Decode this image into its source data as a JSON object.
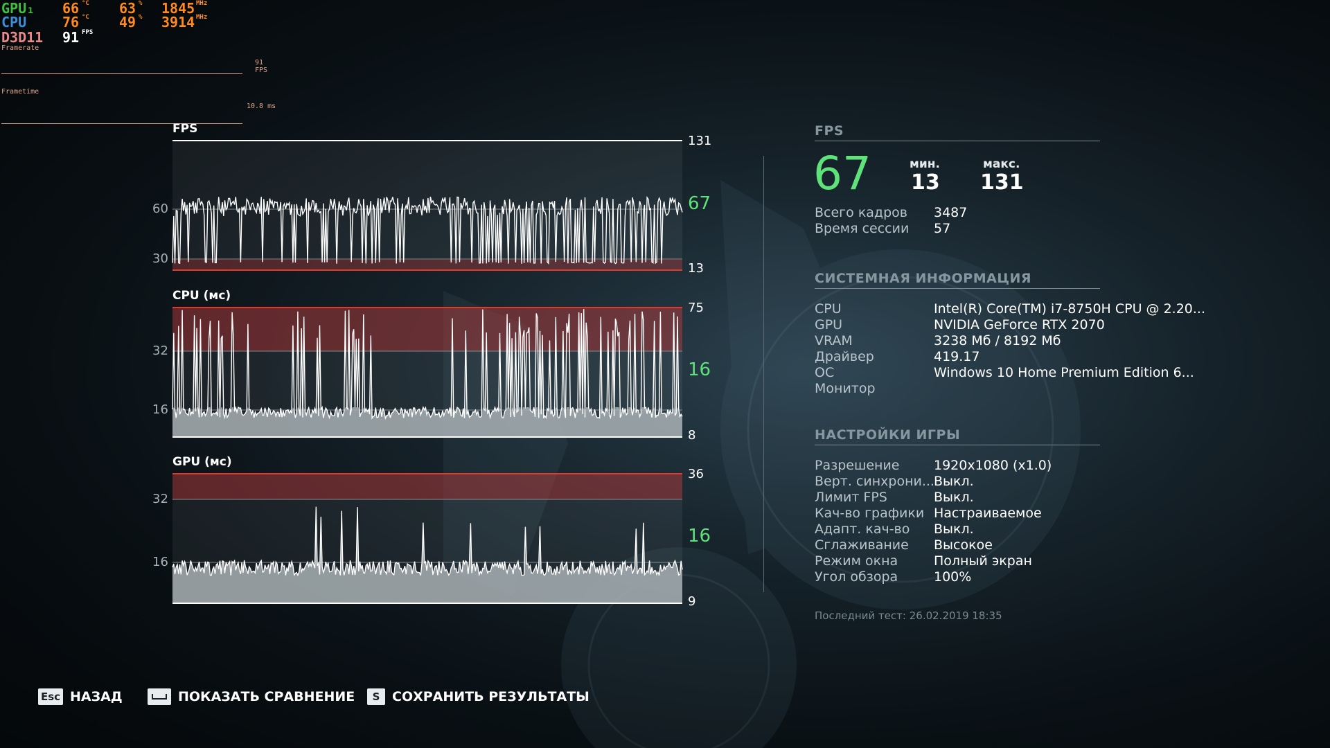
{
  "osd": {
    "rows": [
      {
        "name": "GPU₁",
        "color": "#3fbf3f",
        "temp": "66",
        "temp_unit": "°C",
        "load": "63",
        "load_unit": "%",
        "clock": "1845",
        "clock_unit": "MHz"
      },
      {
        "name": "CPU",
        "color": "#3c8fd8",
        "temp": "76",
        "temp_unit": "°C",
        "load": "49",
        "load_unit": "%",
        "clock": "3914",
        "clock_unit": "MHz"
      }
    ],
    "api": {
      "name": "D3D11",
      "color": "#e88a8a",
      "fps": "91",
      "fps_unit": "FPS"
    },
    "framerate_label": "Framerate",
    "framerate_value": "91 FPS",
    "frametime_label": "Frametime",
    "frametime_value": "10.8 ms"
  },
  "charts": {
    "fps": {
      "title": "FPS",
      "max": "131",
      "current": "67",
      "min": "13",
      "grid": [
        "60",
        "30"
      ]
    },
    "cpu": {
      "title": "CPU (мс)",
      "max": "75",
      "current": "16",
      "min": "8",
      "grid": [
        "32",
        "16"
      ]
    },
    "gpu": {
      "title": "GPU (мс)",
      "max": "36",
      "current": "16",
      "min": "9",
      "grid": [
        "32",
        "16"
      ]
    }
  },
  "chart_data": [
    {
      "type": "line",
      "title": "FPS",
      "ylim": [
        13,
        131
      ],
      "summary": {
        "current": 67,
        "min": 13,
        "max": 131
      },
      "grid": [
        30,
        60
      ]
    },
    {
      "type": "area",
      "title": "CPU (мс)",
      "ylim": [
        8,
        75
      ],
      "summary": {
        "current": 16,
        "min": 8,
        "max": 75
      },
      "grid": [
        16,
        32
      ]
    },
    {
      "type": "area",
      "title": "GPU (мс)",
      "ylim": [
        9,
        36
      ],
      "summary": {
        "current": 16,
        "min": 9,
        "max": 36
      },
      "grid": [
        16,
        32
      ]
    }
  ],
  "panel": {
    "fps_section": "FPS",
    "fps_value": "67",
    "min_label": "мин.",
    "min_value": "13",
    "max_label": "макс.",
    "max_value": "131",
    "stats": [
      {
        "k": "Всего кадров",
        "v": "3487"
      },
      {
        "k": "Время сессии",
        "v": "57"
      }
    ],
    "sys_section": "СИСТЕМНАЯ ИНФОРМАЦИЯ",
    "sys": [
      {
        "k": "CPU",
        "v": "Intel(R) Core(TM) i7-8750H CPU @ 2.20..."
      },
      {
        "k": "GPU",
        "v": "NVIDIA GeForce RTX 2070"
      },
      {
        "k": "VRAM",
        "v": "3238 Мб / 8192 Мб"
      },
      {
        "k": "Драйвер",
        "v": "419.17"
      },
      {
        "k": "ОС",
        "v": "Windows 10 Home Premium Edition 6..."
      },
      {
        "k": "Монитор",
        "v": ""
      }
    ],
    "game_section": "НАСТРОЙКИ ИГРЫ",
    "game": [
      {
        "k": "Разрешение",
        "v": "1920x1080 (x1.0)"
      },
      {
        "k": "Верт. синхрони...",
        "v": "Выкл."
      },
      {
        "k": "Лимит FPS",
        "v": "Выкл."
      },
      {
        "k": "Кач-во графики",
        "v": "Настраиваемое"
      },
      {
        "k": "Адапт. кач-во",
        "v": "Выкл."
      },
      {
        "k": "Сглаживание",
        "v": "Высокое"
      },
      {
        "k": "Режим окна",
        "v": "Полный экран"
      },
      {
        "k": "Угол обзора",
        "v": "100%"
      }
    ],
    "last_test": "Последний тест: 26.02.2019 18:35"
  },
  "footer": {
    "back_key": "Esc",
    "back_label": "НАЗАД",
    "compare_label": "ПОКАЗАТЬ СРАВНЕНИЕ",
    "save_key": "S",
    "save_label": "СОХРАНИТЬ РЕЗУЛЬТАТЫ"
  }
}
